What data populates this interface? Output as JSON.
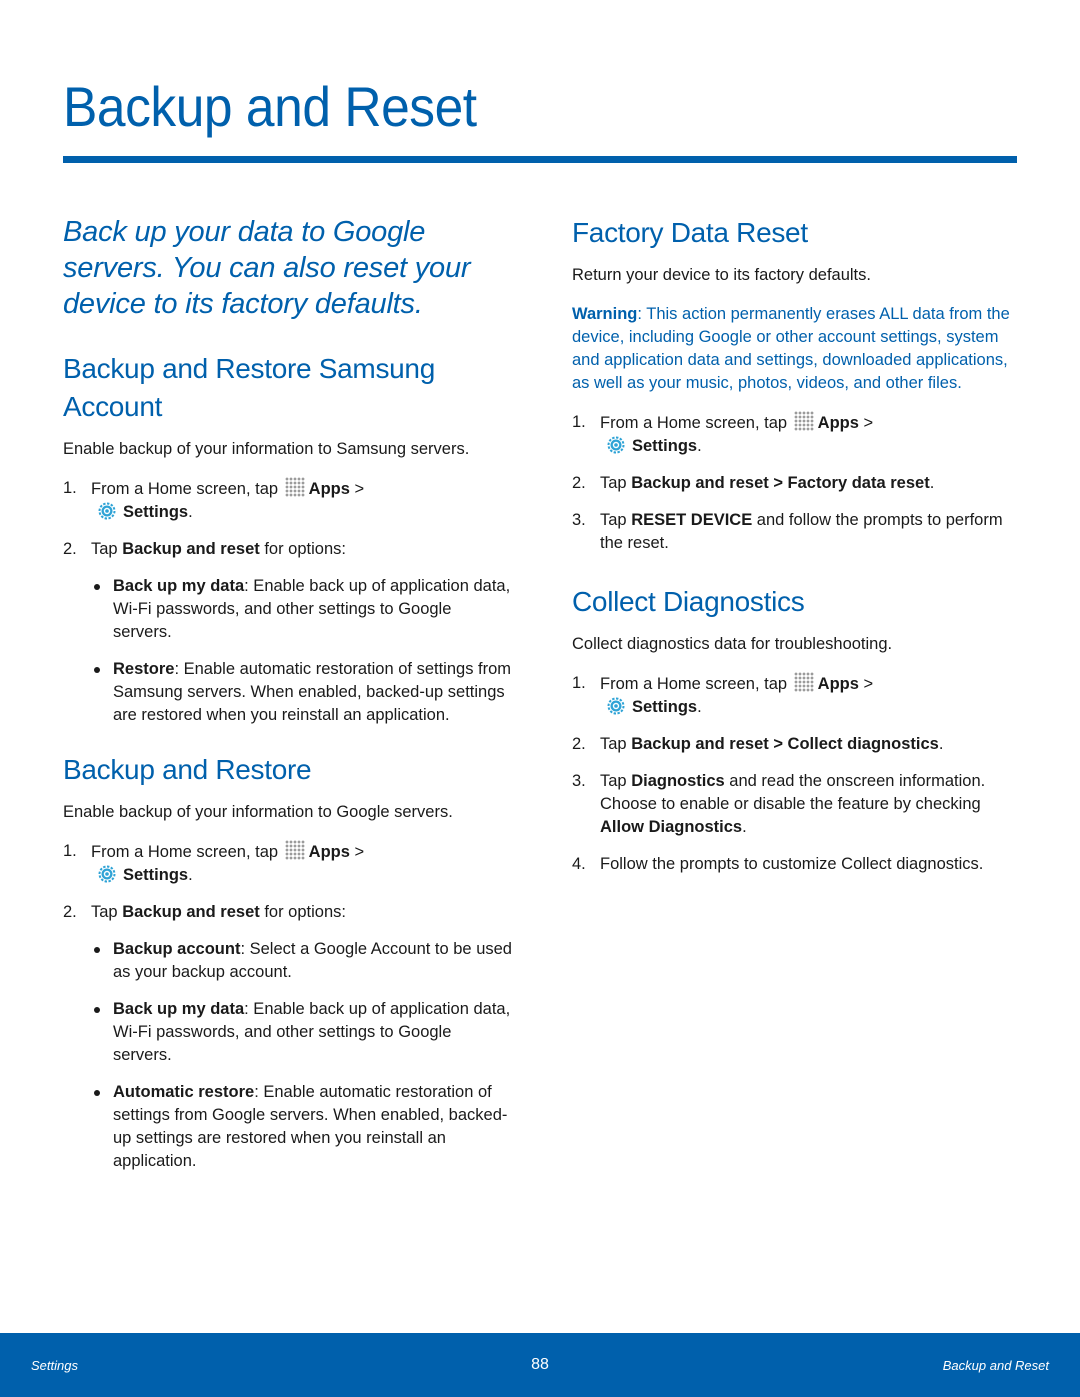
{
  "page": {
    "title": "Backup and Reset",
    "intro": "Back up your data to Google servers. You can also reset your device to its factory defaults."
  },
  "colors": {
    "accent": "#0060ac",
    "text": "#1a1a1a",
    "footer_bg": "#0060ac",
    "settings_icon": "#2fa3d6",
    "apps_icon": "#9b9b9b"
  },
  "common": {
    "step1_prefix": "From a Home screen, tap",
    "apps_label": "Apps",
    "gt": " >",
    "settings_label": "Settings",
    "period": ".",
    "tap": "Tap ",
    "backup_and_reset": "Backup and reset",
    "for_options": " for options:",
    "apps_icon": "apps-grid-icon",
    "settings_icon": "gear-icon"
  },
  "sections": {
    "samsung": {
      "heading": "Backup and Restore Samsung Account",
      "body": "Enable backup of your information to Samsung servers.",
      "bullets": [
        {
          "term": "Back up my data",
          "text": ": Enable back up of application data, Wi-Fi passwords, and other settings to Google servers."
        },
        {
          "term": "Restore",
          "text": ": Enable automatic restoration of settings from Samsung servers. When enabled, backed-up settings are restored when you reinstall an application."
        }
      ]
    },
    "restore": {
      "heading": "Backup and Restore",
      "body": "Enable backup of your information to Google servers.",
      "bullets": [
        {
          "term": "Backup account",
          "text": ": Select a Google Account to be used as your backup account."
        },
        {
          "term": "Back up my data",
          "text": ": Enable back up of application data, Wi-Fi passwords, and other settings to Google servers."
        },
        {
          "term": "Automatic restore",
          "text": ": Enable automatic restoration of settings from Google servers. When enabled, backed-up settings are restored when you reinstall an application."
        }
      ]
    },
    "factory": {
      "heading": "Factory Data Reset",
      "body": "Return your device to its factory defaults.",
      "warning_label": "Warning",
      "warning_text": ": This action permanently erases ALL data from the device, including Google or other account settings, system and application data and settings, downloaded applications, as well as your music, photos, videos, and other files.",
      "step2_target": "Backup and reset > Factory data reset",
      "step3_bold": "RESET DEVICE",
      "step3_text": " and follow the prompts to perform the reset."
    },
    "diagnostics": {
      "heading": "Collect Diagnostics",
      "body": "Collect diagnostics data for troubleshooting.",
      "step2_target": "Backup and reset > Collect diagnostics",
      "step3_bold": "Diagnostics",
      "step3_text": " and read the onscreen information. Choose to enable or disable the feature by checking ",
      "step3_bold2": "Allow Diagnostics",
      "step4_text": "Follow the prompts to customize Collect diagnostics."
    }
  },
  "footer": {
    "left": "Settings",
    "page_number": "88",
    "right": "Backup and Reset"
  }
}
